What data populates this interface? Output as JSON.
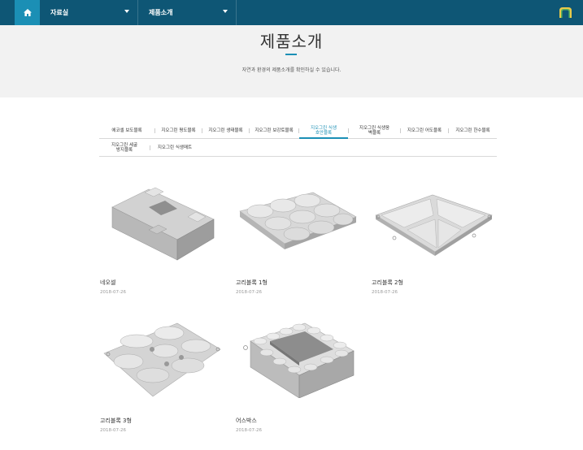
{
  "nav": {
    "home_icon": "home-icon",
    "menu1": "자료실",
    "menu2": "제품소개"
  },
  "header": {
    "title": "제품소개",
    "subtitle": "자연과 환경의 제품소개를 확인하실 수 있습니다."
  },
  "tabs": [
    {
      "label": "에코셀 보도블록"
    },
    {
      "label": "지오그린 평도블록"
    },
    {
      "label": "지오그린 생태블록"
    },
    {
      "label": "지오그린 보강토블록"
    },
    {
      "label": "지오그린 식생호안블록",
      "active": true
    },
    {
      "label": "지오그린 식생옹벽블록"
    },
    {
      "label": "지오그린 어도블록"
    },
    {
      "label": "지오그린 한수블록"
    },
    {
      "label": "지오그린 세굴방지블록"
    },
    {
      "label": "지오그린 식생매트"
    }
  ],
  "products": [
    {
      "name": "네오셀",
      "date": "2018-07-26"
    },
    {
      "name": "고리블록 1형",
      "date": "2018-07-26"
    },
    {
      "name": "고리블록 2형",
      "date": "2018-07-26"
    },
    {
      "name": "고리블록 3형",
      "date": "2018-07-26"
    },
    {
      "name": "어스박스",
      "date": "2018-07-26"
    }
  ],
  "colors": {
    "nav_bg": "#0e5675",
    "accent": "#1b8fb5",
    "header_bg": "#f2f2f2"
  }
}
